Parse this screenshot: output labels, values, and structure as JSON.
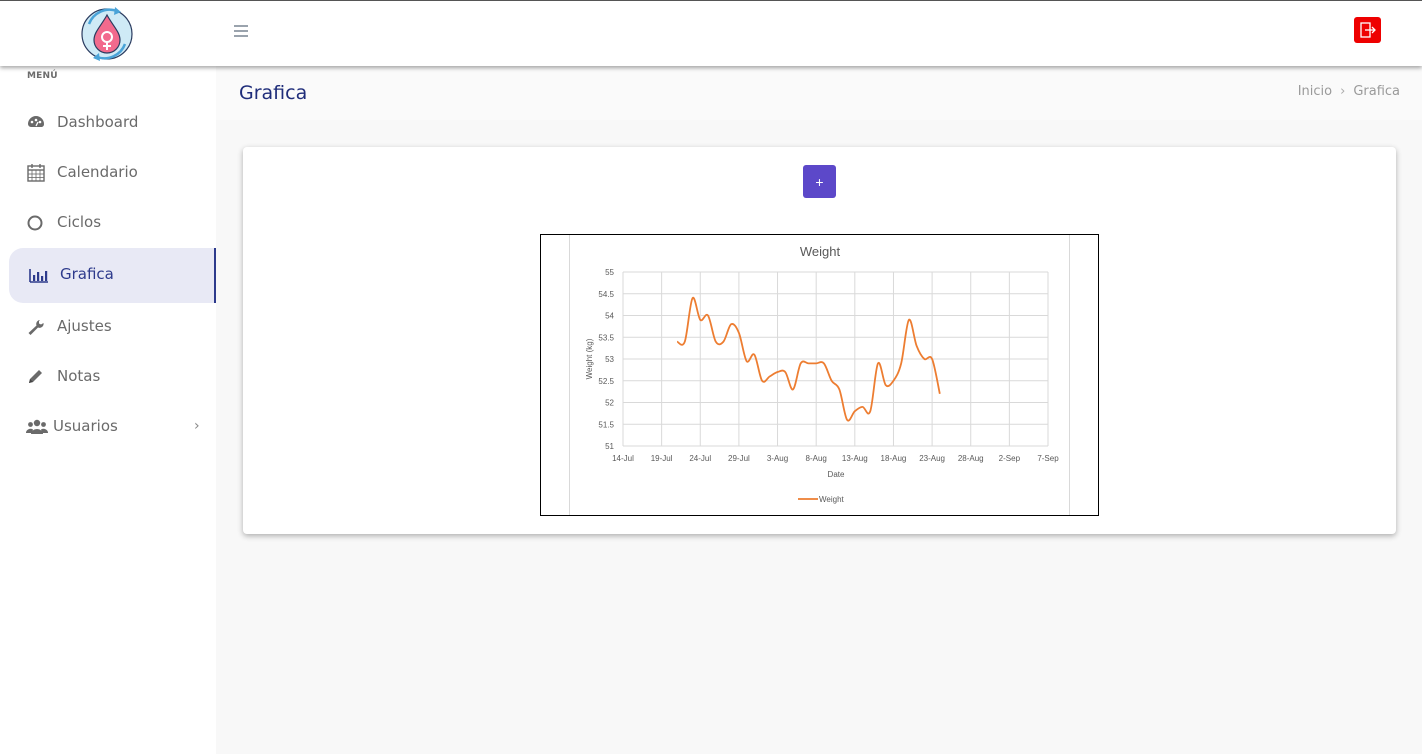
{
  "app": {
    "logo_icon": "female-symbol-drop-icon",
    "logout_icon": "sign-out-icon",
    "brand_colors": {
      "accent": "#5c48c9",
      "primary_text": "#1f2d7a",
      "logout": "#ee0000"
    }
  },
  "sidebar": {
    "header": "MENÚ",
    "items": [
      {
        "label": "Dashboard",
        "icon": "palette-icon"
      },
      {
        "label": "Calendario",
        "icon": "calendar-icon"
      },
      {
        "label": "Ciclos",
        "icon": "circle-icon"
      },
      {
        "label": "Grafica",
        "icon": "bar-chart-icon",
        "active": true
      },
      {
        "label": "Ajustes",
        "icon": "wrench-icon"
      },
      {
        "label": "Notas",
        "icon": "pencil-icon"
      },
      {
        "label": "Usuarios",
        "icon": "users-icon",
        "has_submenu": true
      }
    ]
  },
  "page": {
    "title": "Grafica",
    "breadcrumb": [
      "Inicio",
      "Grafica"
    ],
    "add_button_label": "+"
  },
  "chart_data": {
    "type": "line",
    "title": "Weight",
    "xlabel": "Date",
    "ylabel": "Weight (kg)",
    "xlim": [
      "2019-07-14",
      "2019-09-07"
    ],
    "ylim": [
      51,
      55
    ],
    "x_ticks": [
      "14-Jul",
      "19-Jul",
      "24-Jul",
      "29-Jul",
      "3-Aug",
      "8-Aug",
      "13-Aug",
      "18-Aug",
      "23-Aug",
      "28-Aug",
      "2-Sep",
      "7-Sep"
    ],
    "y_ticks": [
      "51",
      "51.5",
      "52",
      "52.5",
      "53",
      "53.5",
      "54",
      "54.5",
      "55"
    ],
    "grid": true,
    "legend": "bottom",
    "series": [
      {
        "name": "Weight",
        "color": "#ed7d31",
        "x": [
          "2019-07-21",
          "2019-07-22",
          "2019-07-23",
          "2019-07-24",
          "2019-07-25",
          "2019-07-26",
          "2019-07-27",
          "2019-07-28",
          "2019-07-29",
          "2019-07-30",
          "2019-07-31",
          "2019-08-01",
          "2019-08-02",
          "2019-08-03",
          "2019-08-04",
          "2019-08-05",
          "2019-08-06",
          "2019-08-07",
          "2019-08-08",
          "2019-08-09",
          "2019-08-10",
          "2019-08-11",
          "2019-08-12",
          "2019-08-13",
          "2019-08-14",
          "2019-08-15",
          "2019-08-16",
          "2019-08-17",
          "2019-08-18",
          "2019-08-19",
          "2019-08-20",
          "2019-08-21",
          "2019-08-22",
          "2019-08-23",
          "2019-08-24"
        ],
        "values": [
          53.4,
          53.4,
          54.4,
          53.9,
          54.0,
          53.4,
          53.4,
          53.8,
          53.6,
          52.95,
          53.1,
          52.5,
          52.6,
          52.7,
          52.7,
          52.3,
          52.9,
          52.9,
          52.9,
          52.9,
          52.5,
          52.3,
          51.6,
          51.8,
          51.9,
          51.8,
          52.9,
          52.4,
          52.5,
          52.9,
          53.9,
          53.3,
          53.0,
          53.0,
          52.2
        ]
      }
    ]
  }
}
